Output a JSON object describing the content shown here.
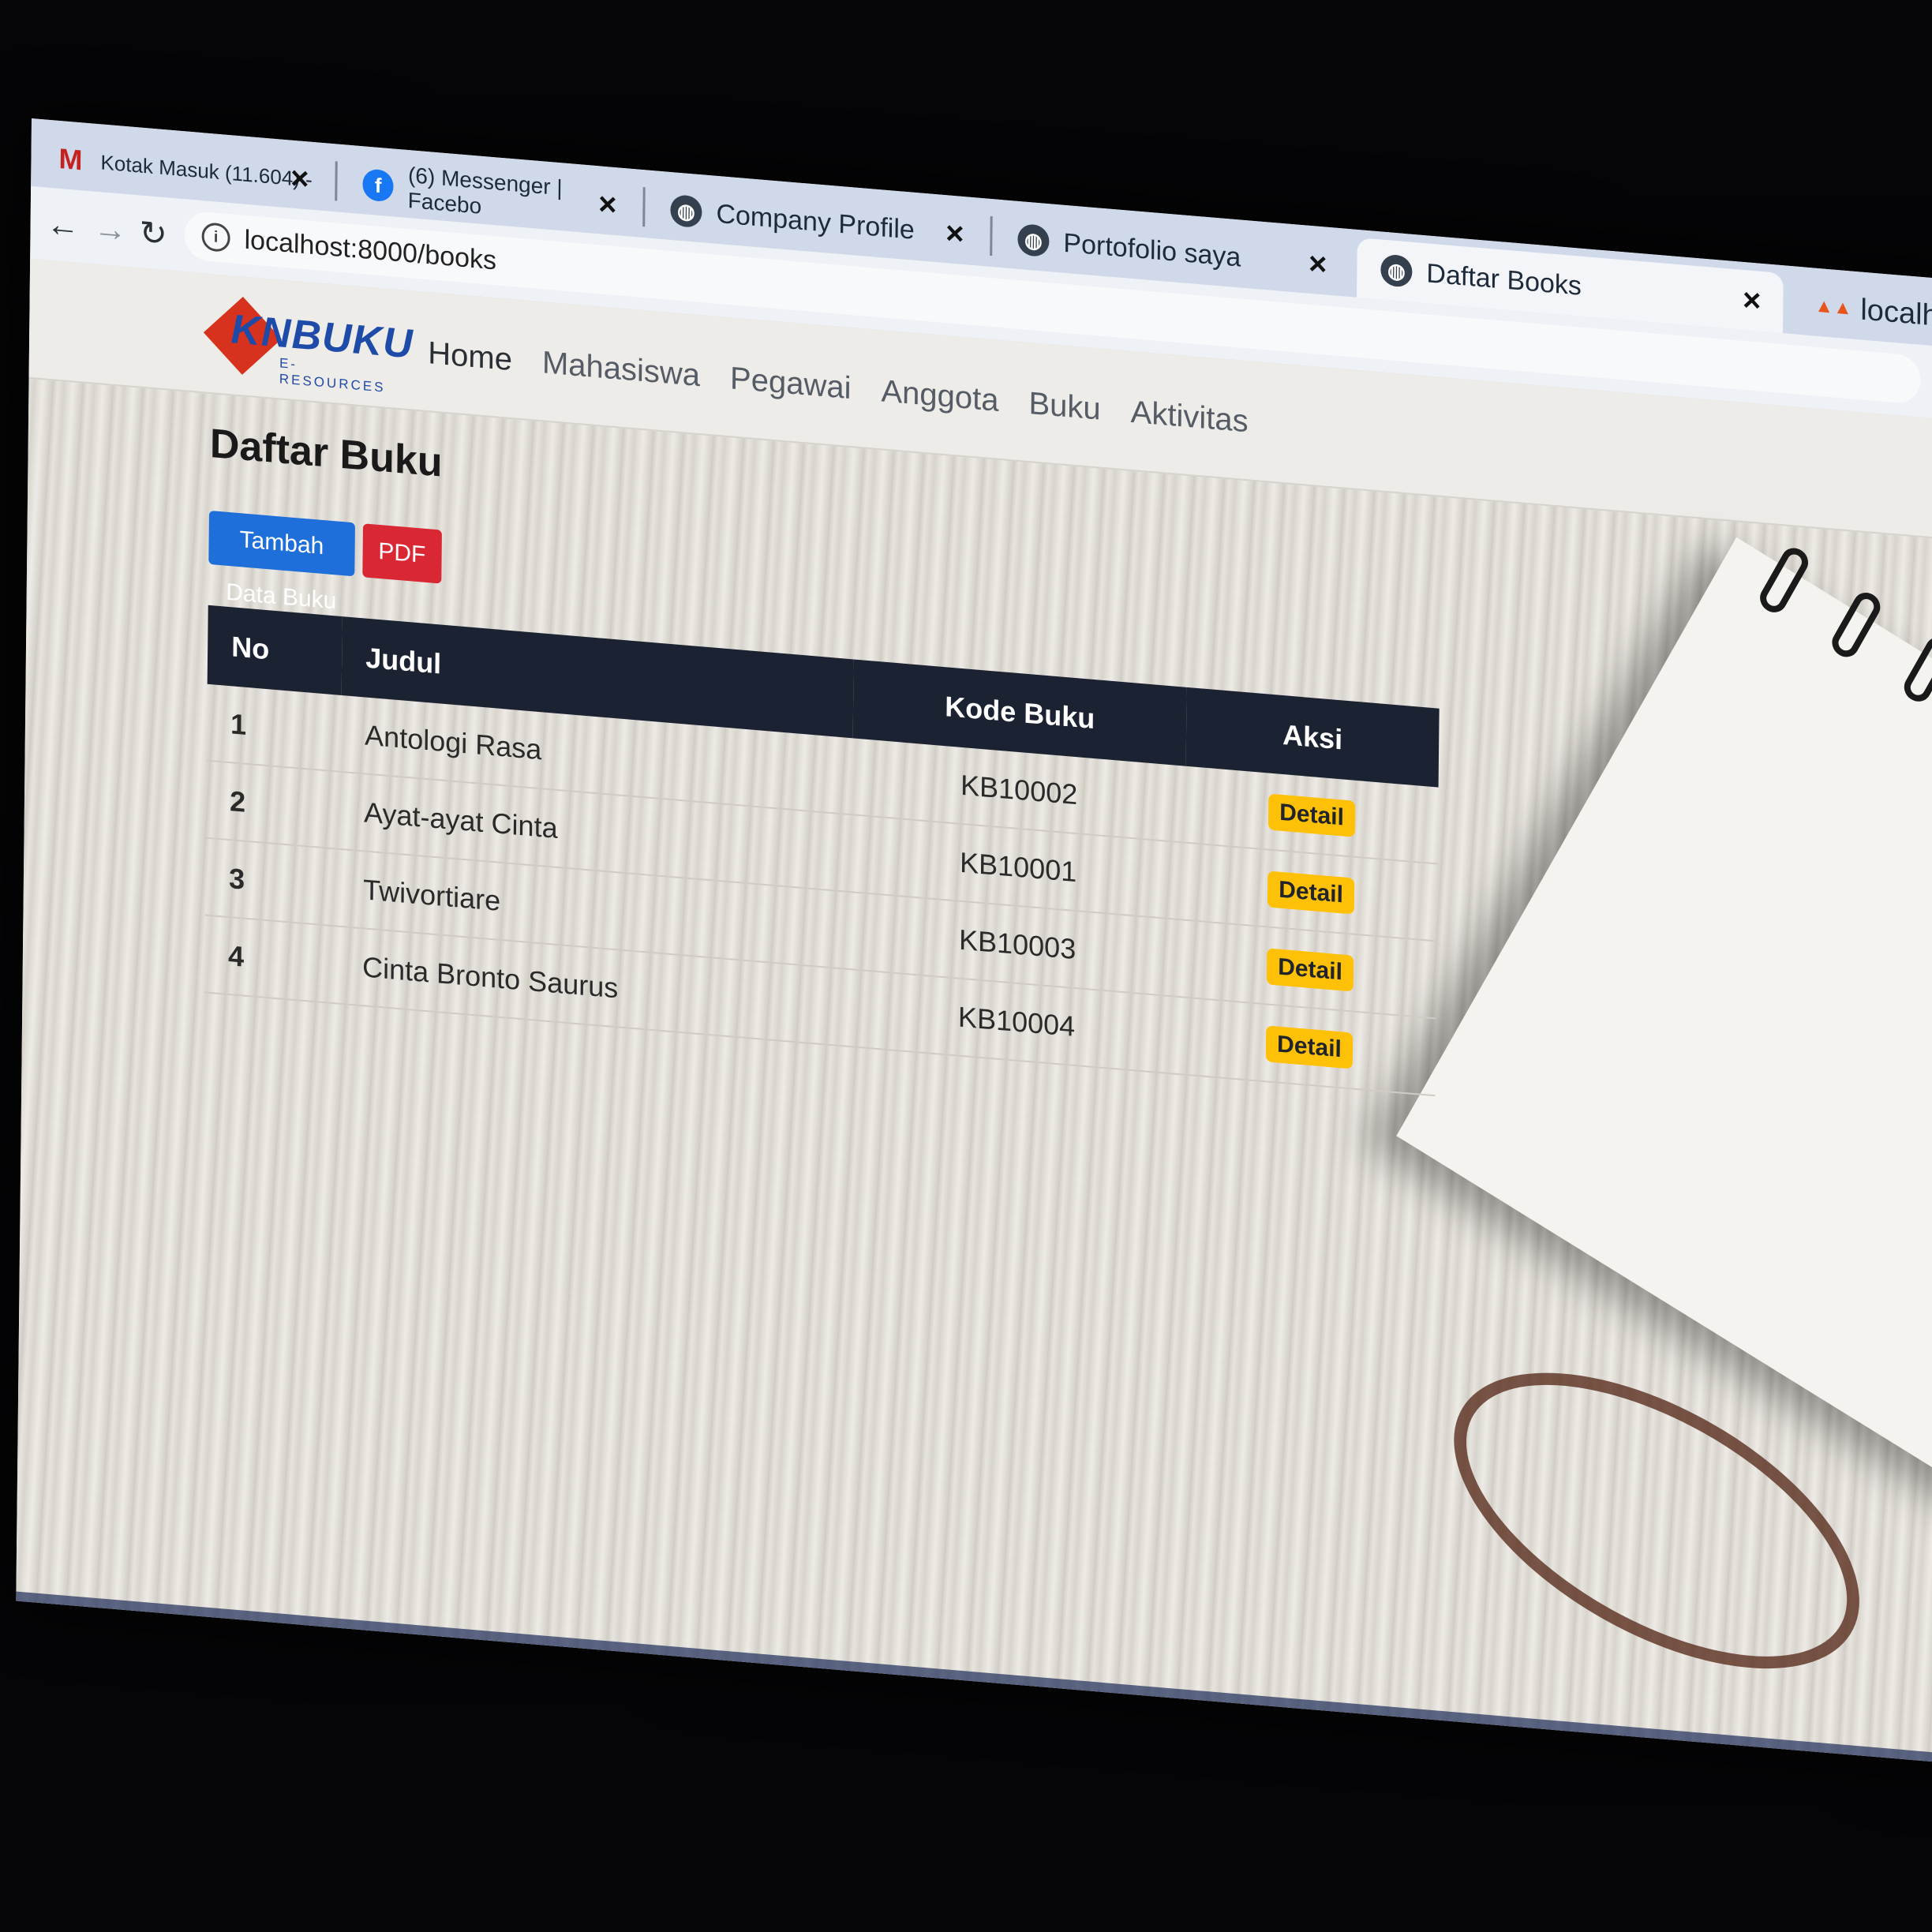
{
  "browser": {
    "tabs": [
      {
        "title": "Kotak Masuk (11.604) -",
        "icon": "gmail-icon"
      },
      {
        "title": "(6) Messenger | Facebo",
        "icon": "facebook-icon"
      },
      {
        "title": "Company Profile",
        "icon": "globe-icon"
      },
      {
        "title": "Portofolio saya",
        "icon": "globe-icon"
      },
      {
        "title": "Daftar Books",
        "icon": "globe-icon",
        "active": true
      },
      {
        "title": "localho",
        "icon": "pma-icon"
      }
    ],
    "close_glyph": "×",
    "url": "localhost:8000/books"
  },
  "navbar": {
    "logo_text": "KNBUKU",
    "logo_sub": "E-RESOURCES",
    "items": [
      "Home",
      "Mahasiswa",
      "Pegawai",
      "Anggota",
      "Buku",
      "Aktivitas"
    ]
  },
  "main": {
    "title": "Daftar Buku",
    "add_button": "Tambah Data Buku",
    "pdf_button": "PDF",
    "table": {
      "headers": [
        "No",
        "Judul",
        "Kode Buku",
        "Aksi"
      ],
      "rows": [
        {
          "no": "1",
          "judul": "Antologi Rasa",
          "kode": "KB10002",
          "aksi": "Detail"
        },
        {
          "no": "2",
          "judul": "Ayat-ayat Cinta",
          "kode": "KB10001",
          "aksi": "Detail"
        },
        {
          "no": "3",
          "judul": "Twivortiare",
          "kode": "KB10003",
          "aksi": "Detail"
        },
        {
          "no": "4",
          "judul": "Cinta Bronto Saurus",
          "kode": "KB10004",
          "aksi": "Detail"
        }
      ]
    }
  },
  "colors": {
    "primary": "#1e6fd9",
    "danger": "#d92734",
    "warning": "#ffc107",
    "table_header": "#1b2332"
  }
}
